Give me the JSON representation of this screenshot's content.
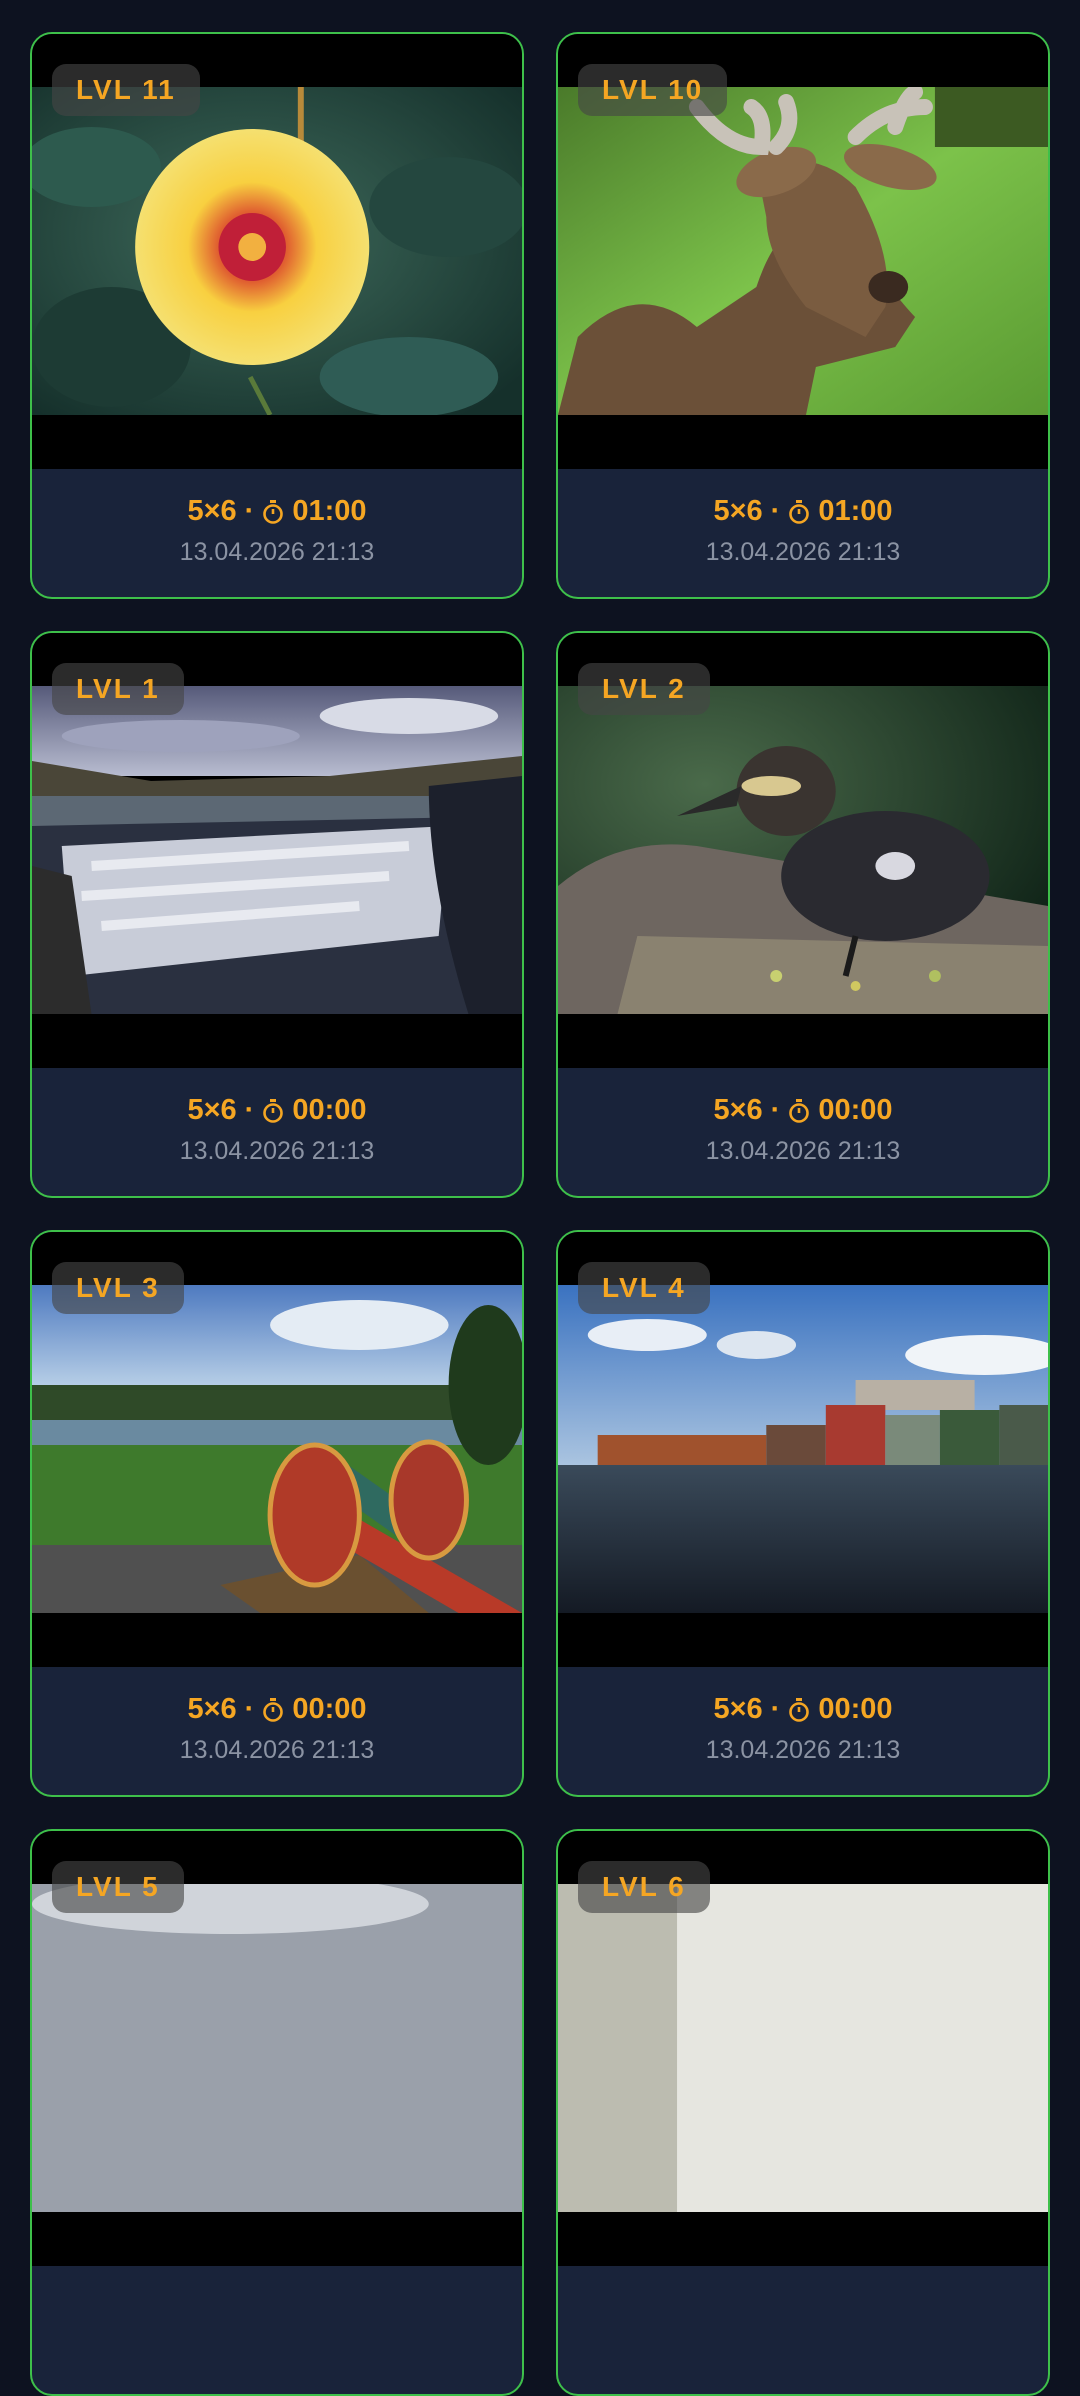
{
  "cards": [
    {
      "level": "LVL 11",
      "grid": "5×6",
      "time": "01:00",
      "date": "13.04.2026 21:13",
      "image": "yellow-dahlia-flower"
    },
    {
      "level": "LVL 10",
      "grid": "5×6",
      "time": "01:00",
      "date": "13.04.2026 21:13",
      "image": "deer-with-velvet-antlers"
    },
    {
      "level": "LVL 1",
      "grid": "5×6",
      "time": "00:00",
      "date": "13.04.2026 21:13",
      "image": "waterfall-landscape"
    },
    {
      "level": "LVL 2",
      "grid": "5×6",
      "time": "00:00",
      "date": "13.04.2026 21:13",
      "image": "duckling-on-rock"
    },
    {
      "level": "LVL 3",
      "grid": "5×6",
      "time": "00:00",
      "date": "13.04.2026 21:13",
      "image": "red-cannon-by-lake"
    },
    {
      "level": "LVL 4",
      "grid": "5×6",
      "time": "00:00",
      "date": "13.04.2026 21:13",
      "image": "riverside-wooden-houses"
    },
    {
      "level": "LVL 5",
      "image": "overcast-sky"
    },
    {
      "level": "LVL 6",
      "image": "bright-sky"
    }
  ],
  "separator": "·",
  "colors": {
    "background": "#0d1220",
    "card": "#19233a",
    "border": "#3ec04a",
    "accent": "#f5a623",
    "date": "#8b93a3"
  }
}
